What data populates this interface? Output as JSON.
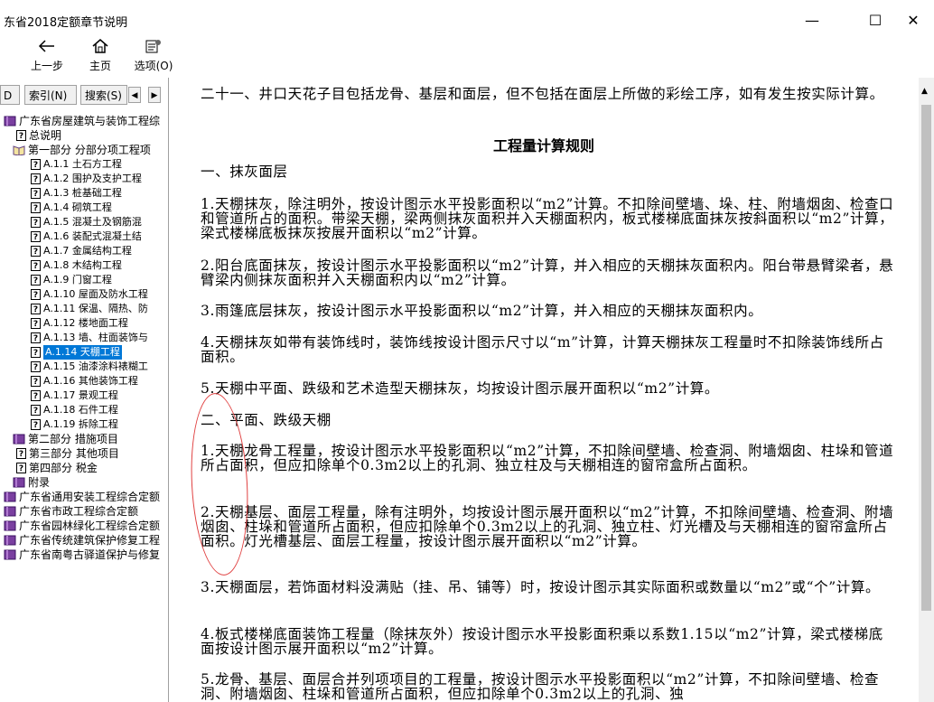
{
  "window": {
    "title": "东省2018定额章节说明",
    "minimize": "—",
    "maximize": "☐",
    "close": "✕"
  },
  "toolbar": {
    "back_label": "上一步",
    "home_label": "主页",
    "options_label": "选项(O)"
  },
  "tabs": {
    "first": "D",
    "index": "索引(N)",
    "search": "搜索(S)",
    "prev": "◀",
    "next": "▶"
  },
  "tree": [
    {
      "label": "广东省房屋建筑与装饰工程综",
      "kind": "book"
    },
    {
      "label": "总说明",
      "kind": "q"
    },
    {
      "label": "第一部分 分部分项工程项",
      "kind": "open"
    },
    {
      "label": "A.1.1 土石方工程",
      "kind": "q"
    },
    {
      "label": "A.1.2 围护及支护工程",
      "kind": "q"
    },
    {
      "label": "A.1.3 桩基础工程",
      "kind": "q"
    },
    {
      "label": "A.1.4 砌筑工程",
      "kind": "q"
    },
    {
      "label": "A.1.5 混凝土及钢筋混",
      "kind": "q"
    },
    {
      "label": "A.1.6 装配式混凝土结",
      "kind": "q"
    },
    {
      "label": "A.1.7 金属结构工程",
      "kind": "q"
    },
    {
      "label": "A.1.8 木结构工程",
      "kind": "q"
    },
    {
      "label": "A.1.9 门窗工程",
      "kind": "q"
    },
    {
      "label": "A.1.10 屋面及防水工程",
      "kind": "q"
    },
    {
      "label": "A.1.11 保温、隔热、防",
      "kind": "q"
    },
    {
      "label": "A.1.12 楼地面工程",
      "kind": "q"
    },
    {
      "label": "A.1.13 墙、柱面装饰与",
      "kind": "q"
    },
    {
      "label": "A.1.14 天棚工程",
      "kind": "q",
      "selected": true
    },
    {
      "label": "A.1.15 油漆涂料裱糊工",
      "kind": "q"
    },
    {
      "label": "A.1.16 其他装饰工程",
      "kind": "q"
    },
    {
      "label": "A.1.17 景观工程",
      "kind": "q"
    },
    {
      "label": "A.1.18 石件工程",
      "kind": "q"
    },
    {
      "label": "A.1.19 拆除工程",
      "kind": "q"
    },
    {
      "label": "第二部分 措施项目",
      "kind": "book"
    },
    {
      "label": "第三部分 其他项目",
      "kind": "q"
    },
    {
      "label": "第四部分 税金",
      "kind": "q"
    },
    {
      "label": "附录",
      "kind": "book"
    },
    {
      "label": "广东省通用安装工程综合定额",
      "kind": "book"
    },
    {
      "label": "广东省市政工程综合定额",
      "kind": "book"
    },
    {
      "label": "广东省园林绿化工程综合定额",
      "kind": "book"
    },
    {
      "label": "广东省传统建筑保护修复工程",
      "kind": "book"
    },
    {
      "label": "广东省南粤古驿道保护与修复",
      "kind": "book"
    }
  ],
  "content": {
    "p0": "二十一、井口天花子目包括龙骨、基层和面层，但不包括在面层上所做的彩绘工序，如有发生按实际计算。",
    "heading": "工程量计算规则",
    "s1": "一、抹灰面层",
    "p1": "1.天棚抹灰，除注明外，按设计图示水平投影面积以“m2”计算。不扣除间壁墙、垛、柱、附墙烟囱、检查口和管道所占的面积。带梁天棚，梁两侧抹灰面积并入天棚面积内，板式楼梯底面抹灰按斜面积以“m2”计算，梁式楼梯底板抹灰按展开面积以“m2”计算。",
    "p2": "2.阳台底面抹灰，按设计图示水平投影面积以“m2”计算，并入相应的天棚抹灰面积内。阳台带悬臂梁者，悬臂梁内侧抹灰面积并入天棚面积内以“m2”计算。",
    "p3": "3.雨篷底层抹灰，按设计图示水平投影面积以“m2”计算，并入相应的天棚抹灰面积内。",
    "p4": "4.天棚抹灰如带有装饰线时，装饰线按设计图示尺寸以“m”计算，计算天棚抹灰工程量时不扣除装饰线所占面积。",
    "p5": "5.天棚中平面、跌级和艺术造型天棚抹灰，均按设计图示展开面积以“m2”计算。",
    "s2": "二、平面、跌级天棚",
    "q1": "1.天棚龙骨工程量，按设计图示水平投影面积以“m2”计算，不扣除间壁墙、检查洞、附墙烟囱、柱垛和管道所占面积，但应扣除单个0.3m2以上的孔洞、独立柱及与天棚相连的窗帘盒所占面积。",
    "q2": "2.天棚基层、面层工程量，除有注明外，均按设计图示展开面积以“m2”计算，不扣除间壁墙、检查洞、附墙烟囱、柱垛和管道所占面积，但应扣除单个0.3m2以上的孔洞、独立柱、灯光槽及与天棚相连的窗帘盒所占面积。灯光槽基层、面层工程量，按设计图示展开面积以“m2”计算。",
    "q3": "3.天棚面层，若饰面材料没满贴（挂、吊、铺等）时，按设计图示其实际面积或数量以“m2”或“个”计算。",
    "q4": "4.板式楼梯底面装饰工程量（除抹灰外）按设计图示水平投影面积乘以系数1.15以“m2”计算，梁式楼梯底面按设计图示展开面积以“m2”计算。",
    "q5": "5.龙骨、基层、面层合并列项项目的工程量，按设计图示水平投影面积以“m2”计算，不扣除间壁墙、检查洞、附墙烟囱、柱垛和管道所占面积，但应扣除单个0.3m2以上的孔洞、独"
  }
}
